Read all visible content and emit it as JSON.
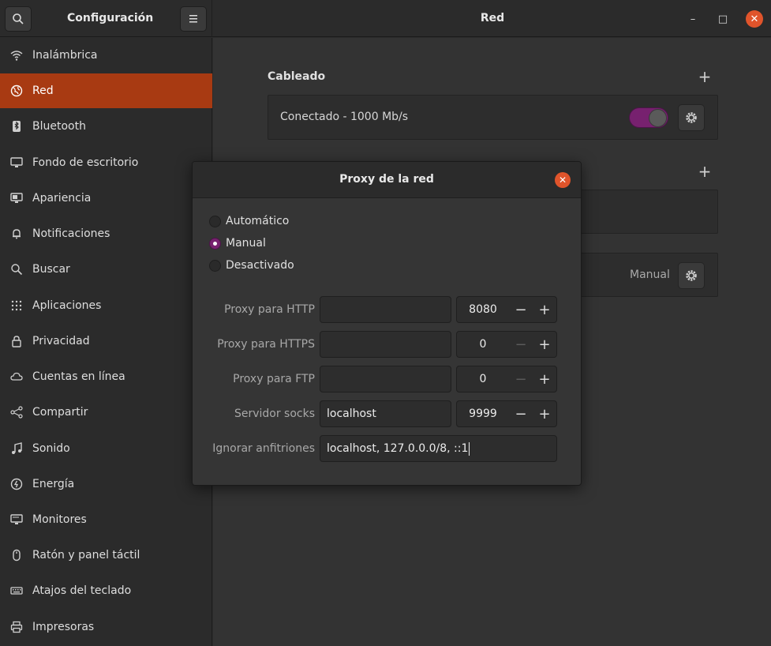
{
  "header": {
    "app_title": "Configuración",
    "page_title": "Red",
    "minimize_glyph": "–",
    "maximize_glyph": "□",
    "close_glyph": "✕"
  },
  "sidebar": {
    "items": [
      {
        "label": "Inalámbrica",
        "icon": "wifi-icon"
      },
      {
        "label": "Red",
        "icon": "network-icon",
        "active": true
      },
      {
        "label": "Bluetooth",
        "icon": "bluetooth-icon"
      },
      {
        "label": "Fondo de escritorio",
        "icon": "display-icon"
      },
      {
        "label": "Apariencia",
        "icon": "appearance-icon"
      },
      {
        "label": "Notificaciones",
        "icon": "bell-icon"
      },
      {
        "label": "Buscar",
        "icon": "search-icon"
      },
      {
        "label": "Aplicaciones",
        "icon": "apps-grid-icon"
      },
      {
        "label": "Privacidad",
        "icon": "lock-icon"
      },
      {
        "label": "Cuentas en línea",
        "icon": "cloud-icon"
      },
      {
        "label": "Compartir",
        "icon": "share-icon"
      },
      {
        "label": "Sonido",
        "icon": "music-note-icon"
      },
      {
        "label": "Energía",
        "icon": "power-icon"
      },
      {
        "label": "Monitores",
        "icon": "monitor-icon"
      },
      {
        "label": "Ratón y panel táctil",
        "icon": "mouse-icon"
      },
      {
        "label": "Atajos del teclado",
        "icon": "keyboard-icon"
      },
      {
        "label": "Impresoras",
        "icon": "printer-icon"
      }
    ]
  },
  "main": {
    "wired_title": "Cableado",
    "wired_status": "Conectado - 1000 Mb/s",
    "wired_enabled": true,
    "proxy_mode_value": "Manual"
  },
  "dialog": {
    "title": "Proxy de la red",
    "radios": [
      {
        "label": "Automático",
        "checked": false
      },
      {
        "label": "Manual",
        "checked": true
      },
      {
        "label": "Desactivado",
        "checked": false
      }
    ],
    "fields": [
      {
        "label": "Proxy para HTTP",
        "host": "",
        "port": "8080",
        "minus_enabled": true
      },
      {
        "label": "Proxy para HTTPS",
        "host": "",
        "port": "0",
        "minus_enabled": false
      },
      {
        "label": "Proxy para FTP",
        "host": "",
        "port": "0",
        "minus_enabled": false
      },
      {
        "label": "Servidor socks",
        "host": "localhost",
        "port": "9999",
        "minus_enabled": true
      }
    ],
    "ignore_label": "Ignorar anfitriones",
    "ignore_value": "localhost, 127.0.0.0/8, ::1"
  },
  "colors": {
    "accent_selection": "#a83a12",
    "toggle_on": "#77216f",
    "close_button": "#e0542b"
  }
}
